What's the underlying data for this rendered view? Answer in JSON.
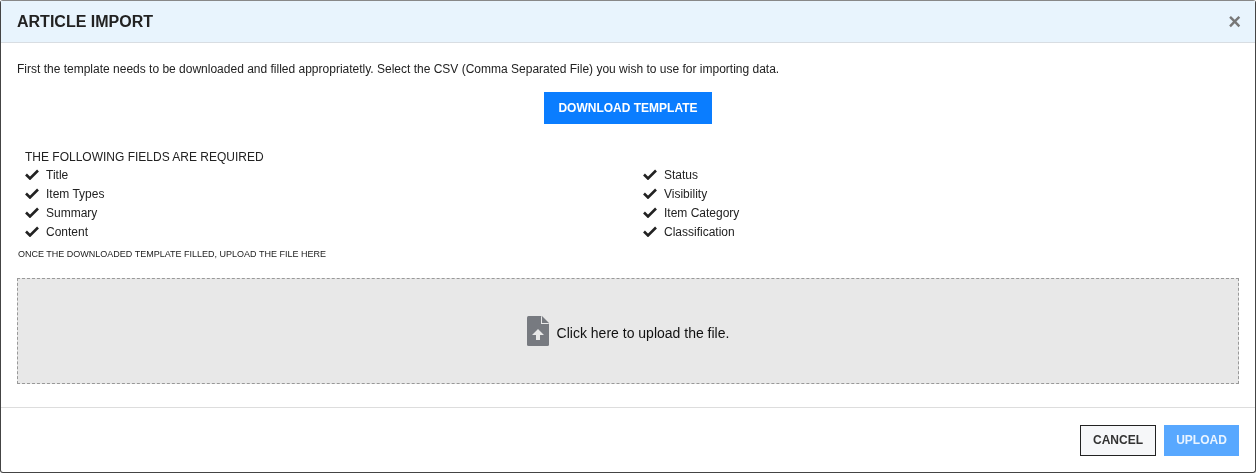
{
  "dialog": {
    "title": "ARTICLE IMPORT",
    "close": "×"
  },
  "intro": "First the template needs to be downloaded and filled appropriatetly. Select the CSV (Comma Separated File) you wish to use for importing data.",
  "download_button": "DOWNLOAD TEMPLATE",
  "required": {
    "heading": "THE FOLLOWING FIELDS ARE REQUIRED",
    "columns": [
      [
        "Title",
        "Item Types",
        "Summary",
        "Content"
      ],
      [
        "Status",
        "Visibility",
        "Item Category",
        "Classification"
      ]
    ]
  },
  "upload_note": "ONCE THE DOWNLOADED TEMPLATE FILLED, UPLOAD THE FILE HERE",
  "dropzone": {
    "label": "Click here to upload the file."
  },
  "buttons": [
    {
      "label": "CANCEL",
      "kind": "secondary",
      "disabled": false
    },
    {
      "label": "UPLOAD",
      "kind": "primary",
      "disabled": true
    }
  ]
}
